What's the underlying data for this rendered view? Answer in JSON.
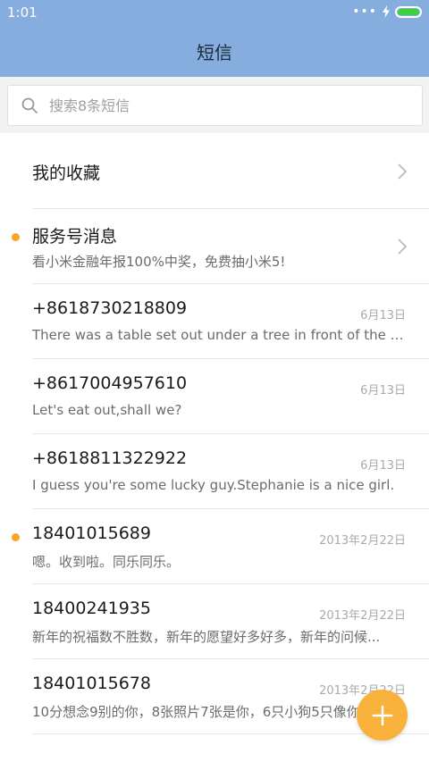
{
  "status_bar": {
    "time": "1:01",
    "dots": "•••",
    "charging_icon": "bolt-icon",
    "battery_color": "#3ed13e"
  },
  "header": {
    "title": "短信",
    "color": "#85aedf"
  },
  "search": {
    "placeholder": "搜索8条短信"
  },
  "favorites": {
    "label": "我的收藏"
  },
  "conversations": [
    {
      "title": "服务号消息",
      "preview": "看小米金融年报100%中奖，免费抽小米5!",
      "date": "",
      "unread": true,
      "chevron": true
    },
    {
      "title": "+8618730218809",
      "preview": "There was a table set out under a tree in front of the ho...",
      "date": "6月13日",
      "unread": false,
      "chevron": false
    },
    {
      "title": "+8617004957610",
      "preview": "Let's eat out,shall we?",
      "date": "6月13日",
      "unread": false,
      "chevron": false
    },
    {
      "title": "+8618811322922",
      "preview": "I guess you're some lucky guy.Stephanie is a nice girl.",
      "date": "6月13日",
      "unread": false,
      "chevron": false
    },
    {
      "title": "18401015689",
      "preview": "嗯。收到啦。同乐同乐。",
      "date": "2013年2月22日",
      "unread": true,
      "chevron": false
    },
    {
      "title": "18400241935",
      "preview": "新年的祝福数不胜数，新年的愿望好多好多，新年的问候...",
      "date": "2013年2月22日",
      "unread": false,
      "chevron": false
    },
    {
      "title": "18401015678",
      "preview": "10分想念9别的你，8张照片7张是你，6只小狗5只像你...",
      "date": "2013年2月22日",
      "unread": false,
      "chevron": false
    }
  ],
  "fab": {
    "icon": "plus-icon",
    "color": "#f8b13a"
  },
  "accent_unread": "#f5a623"
}
